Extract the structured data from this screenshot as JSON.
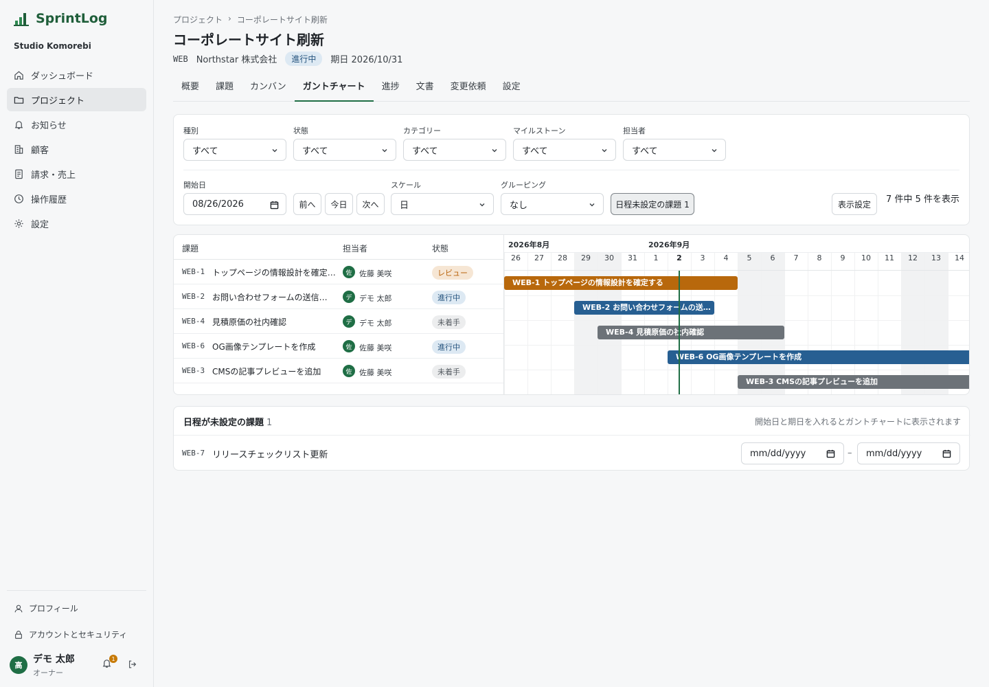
{
  "app": {
    "name": "SprintLog",
    "org": "Studio Komorebi"
  },
  "nav": [
    {
      "label": "ダッシュボード",
      "icon": "home-icon"
    },
    {
      "label": "プロジェクト",
      "icon": "folder-icon",
      "active": true
    },
    {
      "label": "お知らせ",
      "icon": "bell-icon"
    },
    {
      "label": "顧客",
      "icon": "building-icon"
    },
    {
      "label": "請求・売上",
      "icon": "receipt-icon"
    },
    {
      "label": "操作履歴",
      "icon": "clock-icon"
    },
    {
      "label": "設定",
      "icon": "gear-icon"
    }
  ],
  "account": {
    "profile": "プロフィール",
    "security": "アカウントとセキュリティ",
    "user_initial": "高",
    "user_name": "デモ 太郎",
    "user_role": "オーナー",
    "notifications": "1"
  },
  "breadcrumb": [
    "プロジェクト",
    "›",
    "コーポレートサイト刷新"
  ],
  "project": {
    "title": "コーポレートサイト刷新",
    "code": "WEB",
    "client": "Northstar 株式会社",
    "status": "進行中",
    "due": "期日 2026/10/31"
  },
  "tabs": [
    {
      "label": "概要"
    },
    {
      "label": "課題"
    },
    {
      "label": "カンバン"
    },
    {
      "label": "ガントチャート",
      "active": true
    },
    {
      "label": "進捗"
    },
    {
      "label": "文書"
    },
    {
      "label": "変更依頼"
    },
    {
      "label": "設定"
    }
  ],
  "filters": {
    "type_label": "種別",
    "type_value": "すべて",
    "status_label": "状態",
    "status_value": "すべて",
    "category_label": "カテゴリー",
    "category_value": "すべて",
    "milestone_label": "マイルストーン",
    "milestone_value": "すべて",
    "assignee_label": "担当者",
    "assignee_value": "すべて",
    "start_label": "開始日",
    "start_value": "08/26/2026",
    "prev": "前へ",
    "today": "今日",
    "next": "次へ",
    "scale_label": "スケール",
    "scale_value": "日",
    "group_label": "グルーピング",
    "group_value": "なし",
    "unscheduled_toggle": "日程未設定の課題 1",
    "display_settings": "表示設定",
    "count_text": "7 件中 5 件を表示"
  },
  "gantt": {
    "headers": {
      "issue": "課題",
      "assignee": "担当者",
      "status": "状態"
    },
    "months": [
      {
        "label": "2026年8月",
        "start_day_index": 0
      },
      {
        "label": "2026年9月",
        "start_day_index": 6
      }
    ],
    "days": [
      "26",
      "27",
      "28",
      "29",
      "30",
      "31",
      "1",
      "2",
      "3",
      "4",
      "5",
      "6",
      "7",
      "8",
      "9",
      "10",
      "11",
      "12",
      "13",
      "14"
    ],
    "weekend_indices": [
      3,
      4,
      10,
      11,
      17,
      18
    ],
    "today_index": 7,
    "rows": [
      {
        "key": "WEB-1",
        "title": "トップページの情報設計を確定する",
        "list_title": "トップページの情報設計を確定…",
        "assignee_initial": "佐",
        "assignee": "佐藤 美咲",
        "status": "レビュー",
        "status_style": "orange",
        "bar_label": "WEB-1 トップページの情報設計を確定する",
        "start_index": 0,
        "span_days": 10,
        "color": "#b8680c"
      },
      {
        "key": "WEB-2",
        "title": "お問い合わせフォームの送信…",
        "list_title": "お問い合わせフォームの送信…",
        "assignee_initial": "デ",
        "assignee": "デモ 太郎",
        "status": "進行中",
        "status_style": "blue",
        "bar_label": "WEB-2 お問い合わせフォームの送…",
        "start_index": 3,
        "span_days": 6,
        "color": "#275f92"
      },
      {
        "key": "WEB-4",
        "title": "見積原価の社内確認",
        "list_title": "見積原価の社内確認",
        "assignee_initial": "デ",
        "assignee": "デモ 太郎",
        "status": "未着手",
        "status_style": "gray",
        "bar_label": "WEB-4 見積原価の社内確認",
        "start_index": 4,
        "span_days": 8,
        "color": "#6c7278"
      },
      {
        "key": "WEB-6",
        "title": "OG画像テンプレートを作成",
        "list_title": "OG画像テンプレートを作成",
        "assignee_initial": "佐",
        "assignee": "佐藤 美咲",
        "status": "進行中",
        "status_style": "blue",
        "bar_label": "WEB-6 OG画像テンプレートを作成",
        "start_index": 7,
        "span_days": 14,
        "color": "#275f92"
      },
      {
        "key": "WEB-3",
        "title": "CMSの記事プレビューを追加",
        "list_title": "CMSの記事プレビューを追加",
        "assignee_initial": "佐",
        "assignee": "佐藤 美咲",
        "status": "未着手",
        "status_style": "gray",
        "bar_label": "WEB-3 CMSの記事プレビューを追加",
        "start_index": 10,
        "span_days": 10,
        "color": "#6c7278"
      }
    ]
  },
  "unscheduled": {
    "title": "日程が未設定の課題",
    "count": "1",
    "hint": "開始日と期日を入れるとガントチャートに表示されます",
    "items": [
      {
        "key": "WEB-7",
        "title": "リリースチェックリスト更新",
        "start_placeholder": "mm/dd/yyyy",
        "end_placeholder": "mm/dd/yyyy",
        "separator": "–"
      }
    ]
  }
}
